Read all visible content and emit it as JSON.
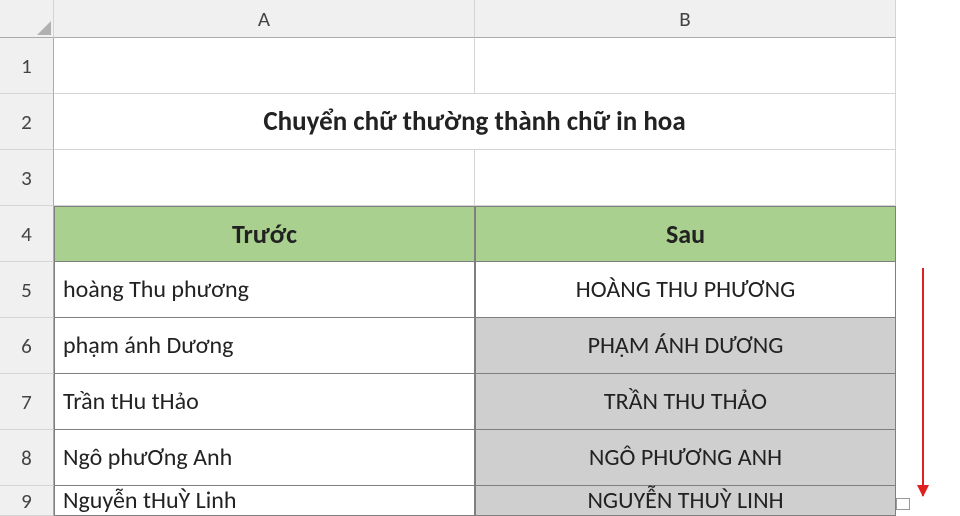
{
  "columns": {
    "A": "A",
    "B": "B"
  },
  "rows": {
    "1": "1",
    "2": "2",
    "3": "3",
    "4": "4",
    "5": "5",
    "6": "6",
    "7": "7",
    "8": "8",
    "9": "9"
  },
  "title": "Chuyển chữ thường thành chữ in hoa",
  "headers": {
    "before": "Trước",
    "after": "Sau"
  },
  "data": [
    {
      "before": "hoàng Thu phương",
      "after": "HOÀNG THU PHƯƠNG"
    },
    {
      "before": "phạm ánh Dương",
      "after": "PHẠM ÁNH DƯƠNG"
    },
    {
      "before": "Trần tHu tHảo",
      "after": "TRẦN THU THẢO"
    },
    {
      "before": "Ngô phưƠng Anh",
      "after": "NGÔ PHƯƠNG ANH"
    },
    {
      "before": "Nguyễn tHuỲ Linh",
      "after": "NGUYỄN THUỲ LINH"
    }
  ]
}
